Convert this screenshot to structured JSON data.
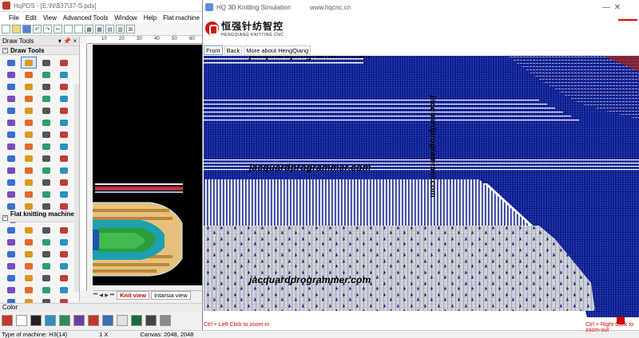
{
  "app": {
    "title": "HqPDS - [E:\\N\\$37\\37-S.pds]",
    "menu": [
      "File",
      "Edit",
      "View",
      "Advanced Tools",
      "Window",
      "Help",
      "Flat machine"
    ]
  },
  "tool_panel": {
    "header": "Draw Tools",
    "header_pin": "▾ 📌 ×",
    "group1": "Draw Tools",
    "group2": "Flat knitting machine ..."
  },
  "ruler": {
    "labels": [
      "10",
      "20",
      "30",
      "40",
      "50",
      "60"
    ]
  },
  "tabs": {
    "knit": "Knit view",
    "intarsia": "Intarsia view"
  },
  "color_panel": {
    "label": "Color"
  },
  "status": {
    "machine": "Type of machine: H3(14)",
    "zoom": "1 X",
    "canvas": "Canvas: 2048, 2048"
  },
  "sim": {
    "title": "HQ 3D Knitting Simulation",
    "site": "www.hqcnc.cn",
    "logo_cn": "恒强针纺智控",
    "logo_en": "HENGQIANG KNITTING CNC",
    "btn_front": "Front",
    "btn_back": "Back",
    "btn_more": "More about HengQiang",
    "watermark": "jacquardprogrammer.com",
    "hint_left": "Ctrl + Left Click to zoom-in",
    "hint_right": "Ctrl + Right Click to zoom-out"
  },
  "colors": {
    "navy": "#0f1f8a",
    "stitch_gray": "#c9ccd4",
    "hint_red": "#dd0000"
  }
}
